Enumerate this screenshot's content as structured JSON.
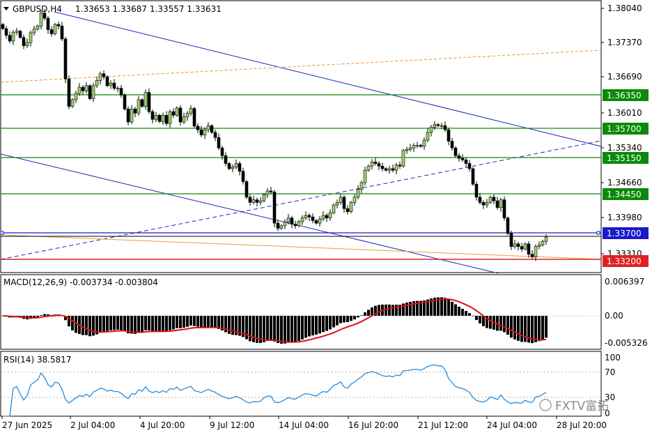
{
  "header": {
    "symbol_timeframe": "GBPUSD,H4",
    "ohlc": "1.33653 1.33687 1.33557 1.33631"
  },
  "price_axis": {
    "ticks": [
      "1.38040",
      "1.37370",
      "1.36690",
      "1.36010",
      "1.35340",
      "1.34660",
      "1.33980",
      "1.33310"
    ],
    "levels": [
      {
        "label": "1.36350",
        "color": "#0a8a0a"
      },
      {
        "label": "1.35700",
        "color": "#0a8a0a"
      },
      {
        "label": "1.35150",
        "color": "#0a8a0a"
      },
      {
        "label": "1.34450",
        "color": "#0a8a0a"
      },
      {
        "label": "1.33700",
        "color": "#1a1acc"
      },
      {
        "label": "1.33200",
        "color": "#e02020"
      }
    ]
  },
  "macd": {
    "title": "MACD(12,26,9) -0.003734 -0.003804",
    "ticks": [
      "0.006397",
      "0.00",
      "-0.005326"
    ]
  },
  "rsi": {
    "title": "RSI(14) 38.5817",
    "ticks": [
      "100",
      "70",
      "30",
      "0"
    ]
  },
  "time_axis": {
    "labels": [
      "27 Jun 2025",
      "2 Jul 04:00",
      "4 Jul 20:00",
      "9 Jul 12:00",
      "14 Jul 04:00",
      "16 Jul 20:00",
      "21 Jul 12:00",
      "24 Jul 04:00",
      "28 Jul 20:00"
    ]
  },
  "watermark": "FXTV富拓",
  "chart_data": {
    "type": "candlestick",
    "title": "GBPUSD,H4",
    "ylim": [
      1.33,
      1.3815
    ],
    "close": [
      1.3765,
      1.3752,
      1.3741,
      1.3758,
      1.376,
      1.3748,
      1.3732,
      1.3738,
      1.3757,
      1.3764,
      1.377,
      1.3795,
      1.3785,
      1.3763,
      1.3755,
      1.3773,
      1.377,
      1.3745,
      1.3668,
      1.3615,
      1.3628,
      1.364,
      1.3652,
      1.3645,
      1.3655,
      1.363,
      1.3655,
      1.3665,
      1.3678,
      1.3672,
      1.3655,
      1.366,
      1.365,
      1.365,
      1.3637,
      1.361,
      1.3585,
      1.361,
      1.3602,
      1.3628,
      1.3615,
      1.3642,
      1.3605,
      1.359,
      1.3598,
      1.3586,
      1.3598,
      1.3582,
      1.3605,
      1.3598,
      1.3612,
      1.3585,
      1.3595,
      1.3602,
      1.3611,
      1.3577,
      1.357,
      1.356,
      1.357,
      1.3578,
      1.3565,
      1.3555,
      1.3535,
      1.352,
      1.3505,
      1.3495,
      1.3498,
      1.3505,
      1.349,
      1.347,
      1.344,
      1.343,
      1.3435,
      1.343,
      1.3433,
      1.3445,
      1.3452,
      1.345,
      1.339,
      1.338,
      1.3385,
      1.3392,
      1.34,
      1.3388,
      1.3385,
      1.3393,
      1.34,
      1.3405,
      1.3402,
      1.3395,
      1.339,
      1.3398,
      1.3405,
      1.34,
      1.341,
      1.3425,
      1.343,
      1.344,
      1.3418,
      1.3412,
      1.343,
      1.344,
      1.3455,
      1.3468,
      1.3492,
      1.35,
      1.3508,
      1.3505,
      1.35,
      1.3495,
      1.3492,
      1.3495,
      1.3492,
      1.3502,
      1.35,
      1.353,
      1.3532,
      1.3535,
      1.354,
      1.354,
      1.3538,
      1.355,
      1.3565,
      1.3575,
      1.358,
      1.3578,
      1.3578,
      1.357,
      1.3548,
      1.3535,
      1.352,
      1.3515,
      1.3512,
      1.3505,
      1.3495,
      1.3465,
      1.344,
      1.343,
      1.3425,
      1.343,
      1.344,
      1.3433,
      1.342,
      1.3435,
      1.34,
      1.337,
      1.3345,
      1.335,
      1.3345,
      1.334,
      1.335,
      1.333,
      1.3325,
      1.3345,
      1.3348,
      1.3355,
      1.3363
    ]
  }
}
